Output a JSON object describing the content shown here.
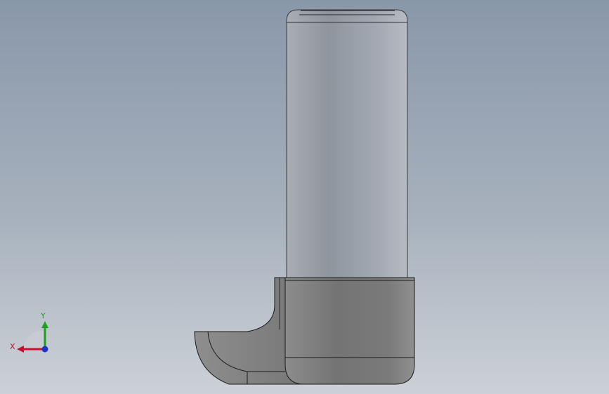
{
  "viewport": {
    "background_top": "#8997aa",
    "background_bottom": "#ccd1d7"
  },
  "model": {
    "body_color": "#a2a7ae",
    "cap_color": "#7d7d7d",
    "edge_color": "#1a1a1a"
  },
  "triad": {
    "x_label": "X",
    "y_label": "Y",
    "x_color": "#c8102e",
    "y_color": "#1aa21a",
    "z_color": "#1a33cc"
  }
}
